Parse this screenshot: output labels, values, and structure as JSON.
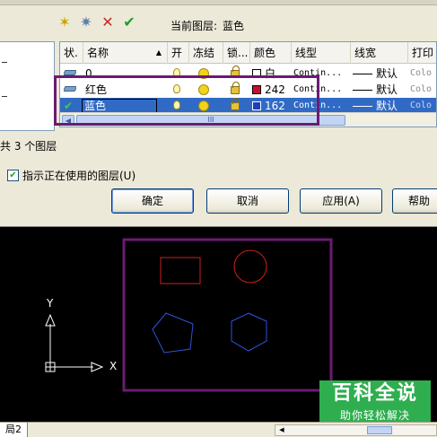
{
  "toolbar": {
    "current_layer_label": "当前图层:",
    "current_layer_value": "蓝色",
    "new_layer_icon": "new-layer-icon",
    "new_layer_vp_icon": "new-layer-vp-frozen-icon",
    "delete_icon": "delete-x-icon",
    "set_current_icon": "set-current-check-icon"
  },
  "columns": [
    "状.",
    "名称",
    "开",
    "冻结",
    "锁...",
    "颜色",
    "线型",
    "线宽",
    "打印"
  ],
  "layers": [
    {
      "status": "",
      "name": "0",
      "color_name": "白",
      "color_hex": "#ffffff",
      "linetype": "Contin...",
      "lineweight": "默认",
      "plot": "Colo"
    },
    {
      "status": "",
      "name": "红色",
      "color_name": "242",
      "color_hex": "#c8102e",
      "linetype": "Contin...",
      "lineweight": "默认",
      "plot": "Colo"
    },
    {
      "status": "✔",
      "name": "蓝色",
      "color_name": "162",
      "color_hex": "#1f3fbf",
      "linetype": "Contin...",
      "lineweight": "默认",
      "plot": "Colo"
    }
  ],
  "layer_count_text": "共 3 个图层",
  "indicator_label": "指示正在使用的图层(U)",
  "buttons": {
    "ok": "确定",
    "cancel": "取消",
    "apply": "应用(A)",
    "help": "帮助"
  },
  "canvas": {
    "axis_y": "Y",
    "axis_x": "X",
    "red_color": "#d11f1f",
    "blue_color": "#2f52d9",
    "frame_color": "#6a1b72"
  },
  "watermark": {
    "title": "百科全说",
    "subtitle": "助你轻松解决"
  },
  "status": {
    "layout_tab": "局2"
  },
  "scroll_grip": "III"
}
